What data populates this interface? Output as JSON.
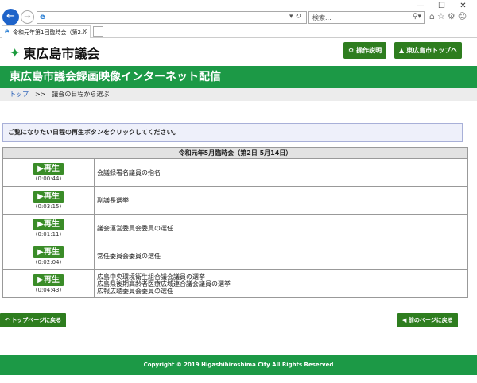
{
  "browser": {
    "search_placeholder": "検索...",
    "tab_title": "令和元年第1回臨時会（第2...",
    "window_controls": [
      "minimize-icon",
      "maximize-icon",
      "close-icon"
    ]
  },
  "header": {
    "logo_text": "東広島市議会",
    "help_button": "操作説明",
    "home_button": "東広島市トップへ",
    "banner_title": "東広島市議会録画映像インターネット配信"
  },
  "breadcrumb": {
    "top_link": "トップ",
    "separator": ">>",
    "current": "議会の日程から選ぶ"
  },
  "notice": "ご覧になりたい日程の再生ボタンをクリックしてください。",
  "schedule": {
    "header": "令和元年5月臨時会（第2日 5月14日）",
    "play_label": "再生",
    "rows": [
      {
        "duration": "(0:00:44)",
        "lines": [
          "会議録署名議員の指名"
        ]
      },
      {
        "duration": "(0:03:15)",
        "lines": [
          "副議長選挙"
        ]
      },
      {
        "duration": "(0:01:11)",
        "lines": [
          "議会運営委員会委員の選任"
        ]
      },
      {
        "duration": "(0:02:04)",
        "lines": [
          "常任委員会委員の選任"
        ]
      },
      {
        "duration": "(0:04:43)",
        "lines": [
          "広島中央環境衛生組合議会議員の選挙",
          "広島県後期高齢者医療広域連合議会議員の選挙",
          "広報広聴委員会委員の選任"
        ]
      }
    ]
  },
  "footer_buttons": {
    "back_top": "トップページに戻る",
    "back_prev": "前のページに戻る"
  },
  "copyright": "Copyright © 2019 Higashihiroshima City All Rights Reserved",
  "colors": {
    "brand_green": "#1c9946",
    "button_green": "#2e7d1f"
  }
}
